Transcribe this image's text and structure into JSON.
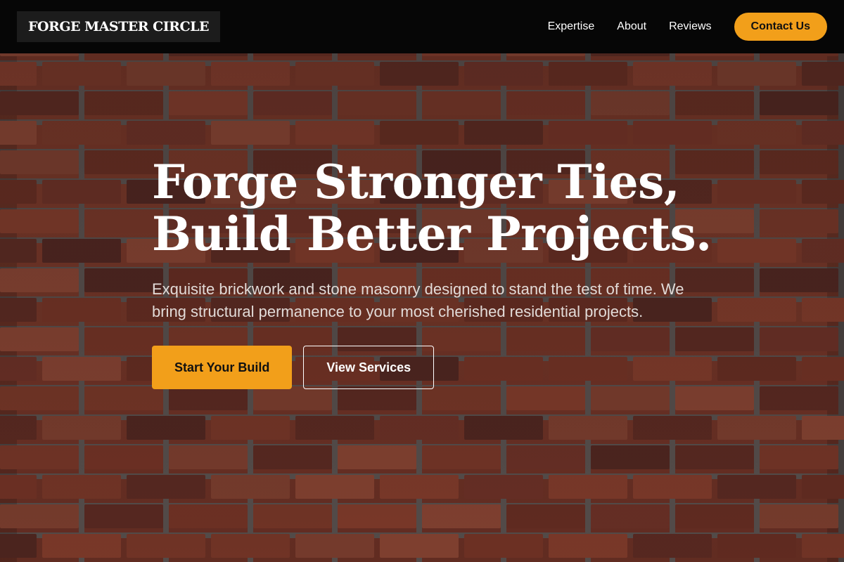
{
  "header": {
    "logo": "FORGE MASTER CIRCLE",
    "nav": [
      {
        "label": "Expertise"
      },
      {
        "label": "About"
      },
      {
        "label": "Reviews"
      }
    ],
    "contact_label": "Contact Us"
  },
  "hero": {
    "title_line1": "Forge Stronger Ties,",
    "title_line2": "Build Better Projects.",
    "subtitle": "Exquisite brickwork and stone masonry designed to stand the test of time. We bring structural permanence to your most cherished residential projects.",
    "primary_cta": "Start Your Build",
    "secondary_cta": "View Services"
  },
  "colors": {
    "accent": "#f29f1a",
    "header_bg": "#060606",
    "brick": "#8b3a28",
    "mortar": "#6a625f"
  }
}
